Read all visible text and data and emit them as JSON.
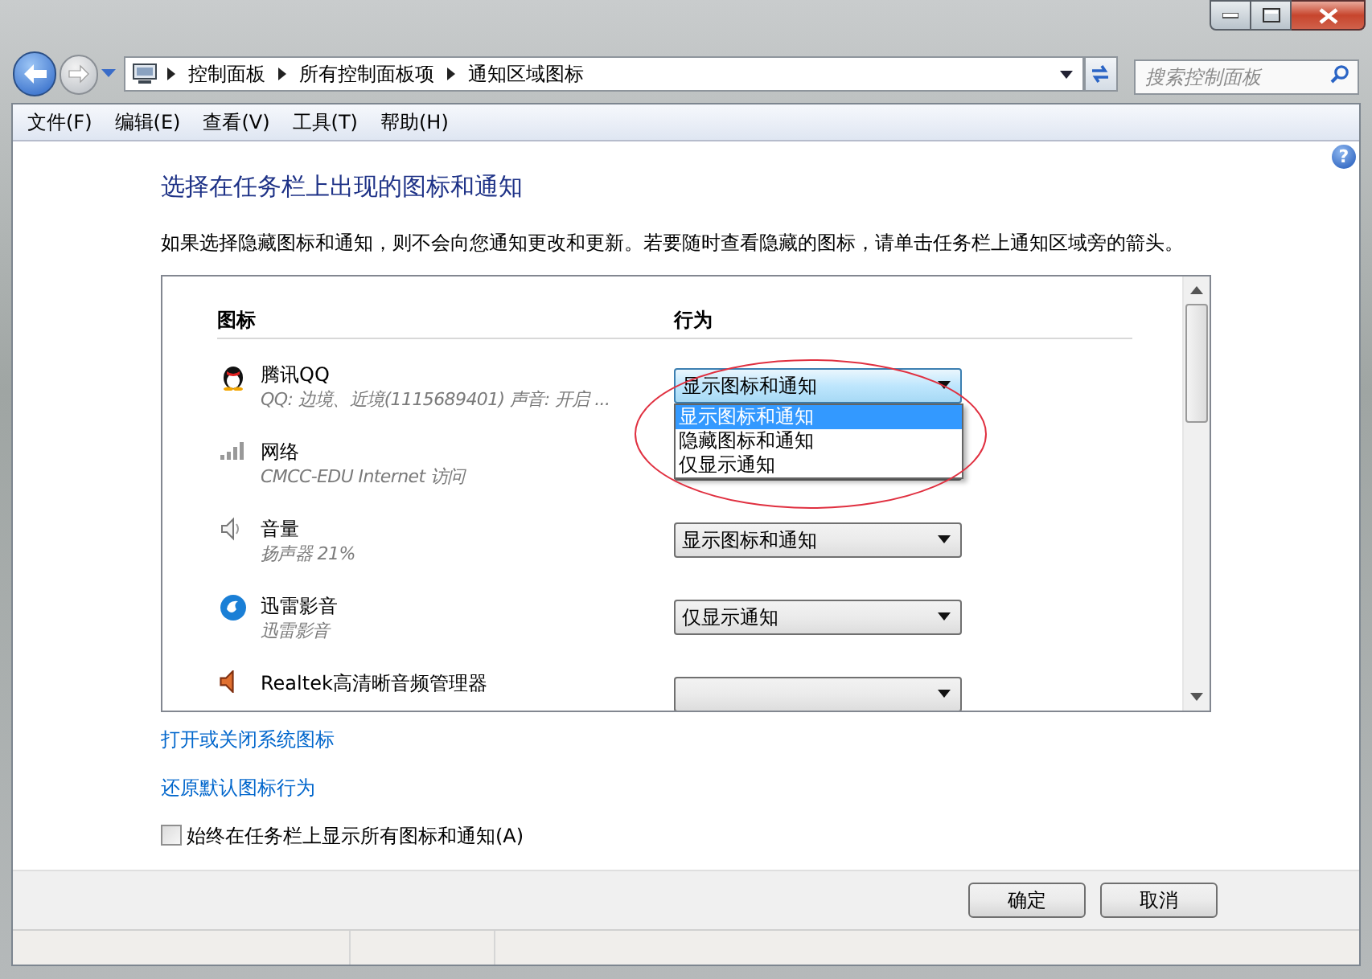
{
  "nav": {
    "breadcrumbs": [
      "控制面板",
      "所有控制面板项",
      "通知区域图标"
    ],
    "search_placeholder": "搜索控制面板"
  },
  "menu": [
    "文件(F)",
    "编辑(E)",
    "查看(V)",
    "工具(T)",
    "帮助(H)"
  ],
  "help": "?",
  "heading": "选择在任务栏上出现的图标和通知",
  "description": "如果选择隐藏图标和通知，则不会向您通知更改和更新。若要随时查看隐藏的图标，请单击任务栏上通知区域旁的箭头。",
  "table": {
    "columns": [
      "图标",
      "行为"
    ],
    "rows": [
      {
        "kind": "penguin",
        "name": "腾讯QQ",
        "detail": "QQ: 边境、近境(1115689401)  声音: 开启 ...",
        "behavior": "显示图标和通知",
        "open": true,
        "options": [
          {
            "label": "显示图标和通知",
            "selected": true
          },
          {
            "label": "隐藏图标和通知",
            "selected": false
          },
          {
            "label": "仅显示通知",
            "selected": false
          }
        ]
      },
      {
        "kind": "signal",
        "name": "网络",
        "detail": "CMCC-EDU Internet 访问",
        "open": false
      },
      {
        "kind": "speaker",
        "name": "音量",
        "detail": "扬声器 21%",
        "behavior": "显示图标和通知",
        "open": false
      },
      {
        "kind": "swirl",
        "name": "迅雷影音",
        "detail": "迅雷影音",
        "behavior": "仅显示通知",
        "open": false
      },
      {
        "kind": "speaker-red",
        "name": "Realtek高清晰音频管理器",
        "open": false
      }
    ]
  },
  "links": [
    "打开或关闭系统图标",
    "还原默认图标行为"
  ],
  "always_show": {
    "label": "始终在任务栏上显示所有图标和通知(A)",
    "checked": false
  },
  "buttons": [
    "确定",
    "取消"
  ],
  "annotation": {
    "kind": "ellipse"
  }
}
